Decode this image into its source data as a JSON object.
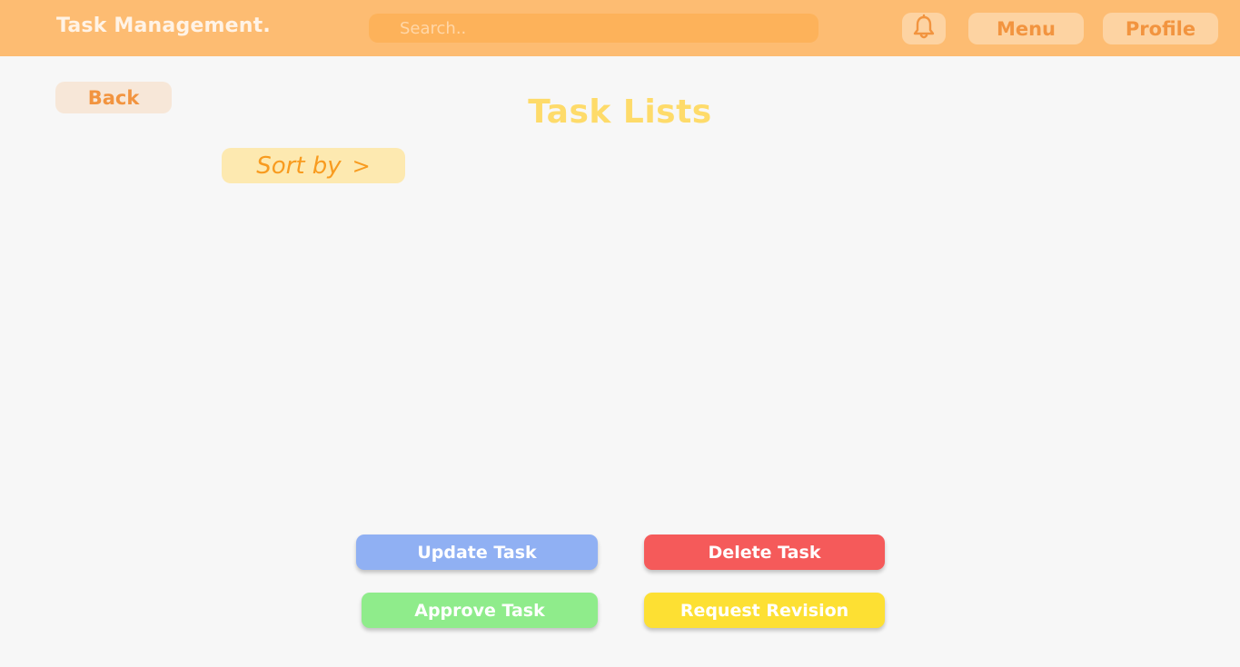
{
  "header": {
    "brand": "Task Management.",
    "search_placeholder": "Search..",
    "notification_icon": "bell-icon",
    "menu_label": "Menu",
    "profile_label": "Profile"
  },
  "main": {
    "back_label": "Back",
    "title": "Task Lists",
    "sort_label": "Sort by",
    "sort_chevron": ">"
  },
  "actions": {
    "update": "Update Task",
    "delete": "Delete Task",
    "approve": "Approve Task",
    "revision": "Request Revision"
  },
  "colors": {
    "header_bg": "#fdbc72",
    "accent_orange": "#f2943f",
    "title_yellow": "#fedb6a",
    "update_blue": "#90b0f3",
    "delete_red": "#f55a5a",
    "approve_green": "#8fec8b",
    "revision_yellow": "#fde033"
  }
}
